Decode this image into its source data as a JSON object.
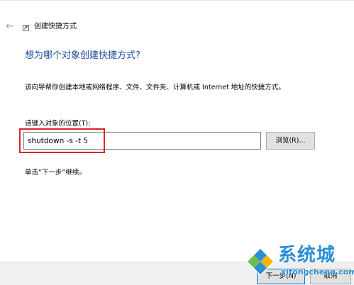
{
  "header": {
    "back_icon": "back-arrow-icon",
    "app_icon": "shortcut-icon",
    "title": "创建快捷方式"
  },
  "main": {
    "heading": "想为哪个对象创建快捷方式?",
    "description": "该向导帮你创建本地或网络程序、文件、文件夹、计算机或 Internet 地址的快捷方式。",
    "location_label": "请键入对象的位置(T):",
    "location_value": "shutdown -s -t 5",
    "browse_label": "浏览(R)...",
    "hint": "单击“下一步”继续。"
  },
  "footer": {
    "next_label": "下一步(N)",
    "cancel_label": "取消"
  },
  "watermark": {
    "text": "系统城",
    "url": "xitongcheng.com"
  },
  "colors": {
    "heading": "#1e4b9a",
    "highlight": "#d9262a",
    "watermark": "#2a8fd6"
  }
}
